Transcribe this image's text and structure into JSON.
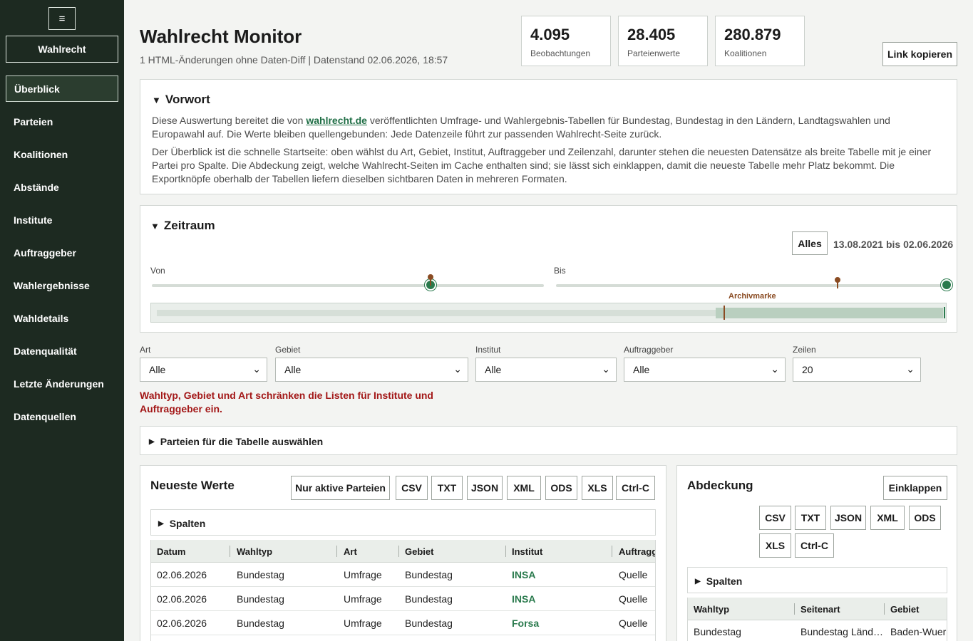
{
  "sidebar": {
    "menu_icon": "hamburger-icon",
    "brand": "Wahlrecht",
    "items": [
      {
        "label": "Überblick",
        "active": true
      },
      {
        "label": "Parteien"
      },
      {
        "label": "Koalitionen"
      },
      {
        "label": "Abstände"
      },
      {
        "label": "Institute"
      },
      {
        "label": "Auftraggeber"
      },
      {
        "label": "Wahlergebnisse"
      },
      {
        "label": "Wahldetails"
      },
      {
        "label": "Datenqualität"
      },
      {
        "label": "Letzte Änderungen"
      },
      {
        "label": "Datenquellen"
      }
    ]
  },
  "header": {
    "title": "Wahlrecht Monitor",
    "subtitle": "1 HTML-Änderungen ohne Daten-Diff | Datenstand 02.06.2026, 18:57",
    "stats": [
      {
        "value": "4.095",
        "label": "Beobachtungen"
      },
      {
        "value": "28.405",
        "label": "Parteienwerte"
      },
      {
        "value": "280.879",
        "label": "Koalitionen"
      }
    ],
    "copy_link": "Link kopieren"
  },
  "vorwort": {
    "title": "Vorwort",
    "p1_before": "Diese Auswertung bereitet die von ",
    "p1_link": "wahlrecht.de",
    "p1_after": " veröffentlichten Umfrage- und Wahlergebnis-Tabellen für Bundestag, Bundestag in den Ländern, Landtagswahlen und Europawahl auf. Die Werte bleiben quellengebunden: Jede Datenzeile führt zur passenden Wahlrecht-Seite zurück.",
    "p2": "Der Überblick ist die schnelle Startseite: oben wählst du Art, Gebiet, Institut, Auftraggeber und Zeilenzahl, darunter stehen die neuesten Datensätze als breite Tabelle mit je einer Partei pro Spalte. Die Abdeckung zeigt, welche Wahlrecht-Seiten im Cache enthalten sind; sie lässt sich einklappen, damit die neueste Tabelle mehr Platz bekommt. Die Exportknöpfe oberhalb der Tabellen liefern dieselben sichtbaren Daten in mehreren Formaten."
  },
  "zeitraum": {
    "title": "Zeitraum",
    "all_button": "Alles",
    "range_text": "13.08.2021 bis 02.06.2026",
    "from_label": "Von",
    "to_label": "Bis",
    "archive_label": "Archivmarke",
    "from_position": 0.71,
    "to_position": 1.0,
    "archive_position": 0.72
  },
  "filters": {
    "art": {
      "label": "Art",
      "value": "Alle"
    },
    "gebiet": {
      "label": "Gebiet",
      "value": "Alle"
    },
    "institut": {
      "label": "Institut",
      "value": "Alle"
    },
    "auftraggeber": {
      "label": "Auftraggeber",
      "value": "Alle"
    },
    "zeilen": {
      "label": "Zeilen",
      "value": "20"
    },
    "warning": "Wahltyp, Gebiet und Art schränken die Listen für Institute und Auftraggeber ein."
  },
  "parteien_toggle": "Parteien für die Tabelle auswählen",
  "neueste": {
    "title": "Neueste Werte",
    "active_only": "Nur aktive Parteien",
    "exports": [
      "CSV",
      "TXT",
      "JSON",
      "XML",
      "ODS",
      "XLS",
      "Ctrl-C"
    ],
    "columns_toggle": "Spalten",
    "headers": [
      "Datum",
      "Wahltyp",
      "Art",
      "Gebiet",
      "Institut",
      "Auftragg"
    ],
    "rows": [
      [
        "02.06.2026",
        "Bundestag",
        "Umfrage",
        "Bundestag",
        "INSA",
        "Quelle"
      ],
      [
        "02.06.2026",
        "Bundestag",
        "Umfrage",
        "Bundestag",
        "INSA",
        "Quelle"
      ],
      [
        "02.06.2026",
        "Bundestag",
        "Umfrage",
        "Bundestag",
        "Forsa",
        "Quelle"
      ]
    ]
  },
  "abdeckung": {
    "title": "Abdeckung",
    "collapse": "Einklappen",
    "exports": [
      "CSV",
      "TXT",
      "JSON",
      "XML",
      "ODS",
      "XLS",
      "Ctrl-C"
    ],
    "columns_toggle": "Spalten",
    "headers": [
      "Wahltyp",
      "Seitenart",
      "Gebiet"
    ],
    "rows": [
      [
        "Bundestag",
        "Bundestag Länd…",
        "Baden-Wuer"
      ]
    ]
  },
  "colors": {
    "sidebar_bg": "#1d2a21",
    "accent_green": "#2a7a4d",
    "archive_marker": "#8a4b22",
    "warning_red": "#a31818"
  }
}
